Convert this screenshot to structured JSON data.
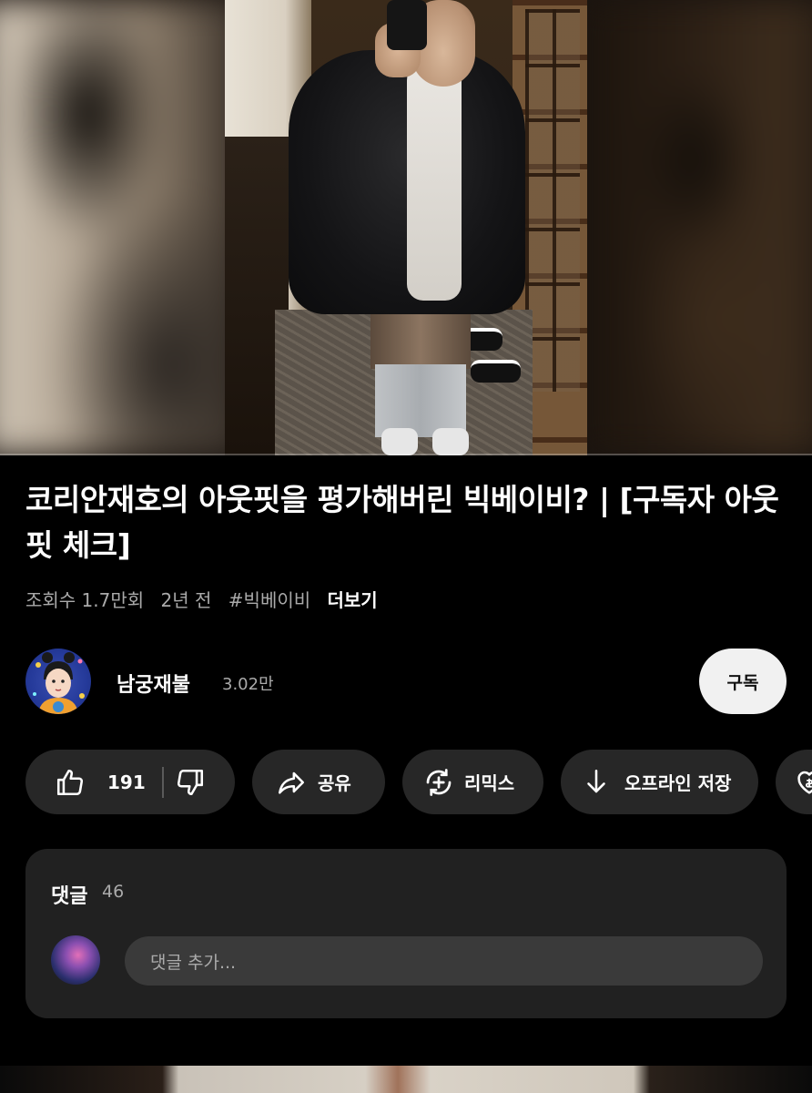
{
  "video": {
    "title": "코리안재호의 아웃핏을 평가해버린 빅베이비? | [구독자 아웃핏 체크]",
    "views": "조회수 1.7만회",
    "age": "2년 전",
    "hashtag": "#빅베이비",
    "more_label": "더보기",
    "progress_fraction": 0.0
  },
  "channel": {
    "name": "남궁재불",
    "subscribers": "3.02만",
    "subscribe_label": "구독"
  },
  "actions": {
    "like_count": "191",
    "share_label": "공유",
    "remix_label": "리믹스",
    "download_label": "오프라인 저장"
  },
  "comments": {
    "label": "댓글",
    "count": "46",
    "placeholder": "댓글 추가..."
  },
  "icons": {
    "like": "thumbs-up-icon",
    "dislike": "thumbs-down-icon",
    "share": "share-arrow-icon",
    "remix": "remix-icon",
    "download": "download-icon",
    "thanks": "heart-dollar-icon"
  }
}
